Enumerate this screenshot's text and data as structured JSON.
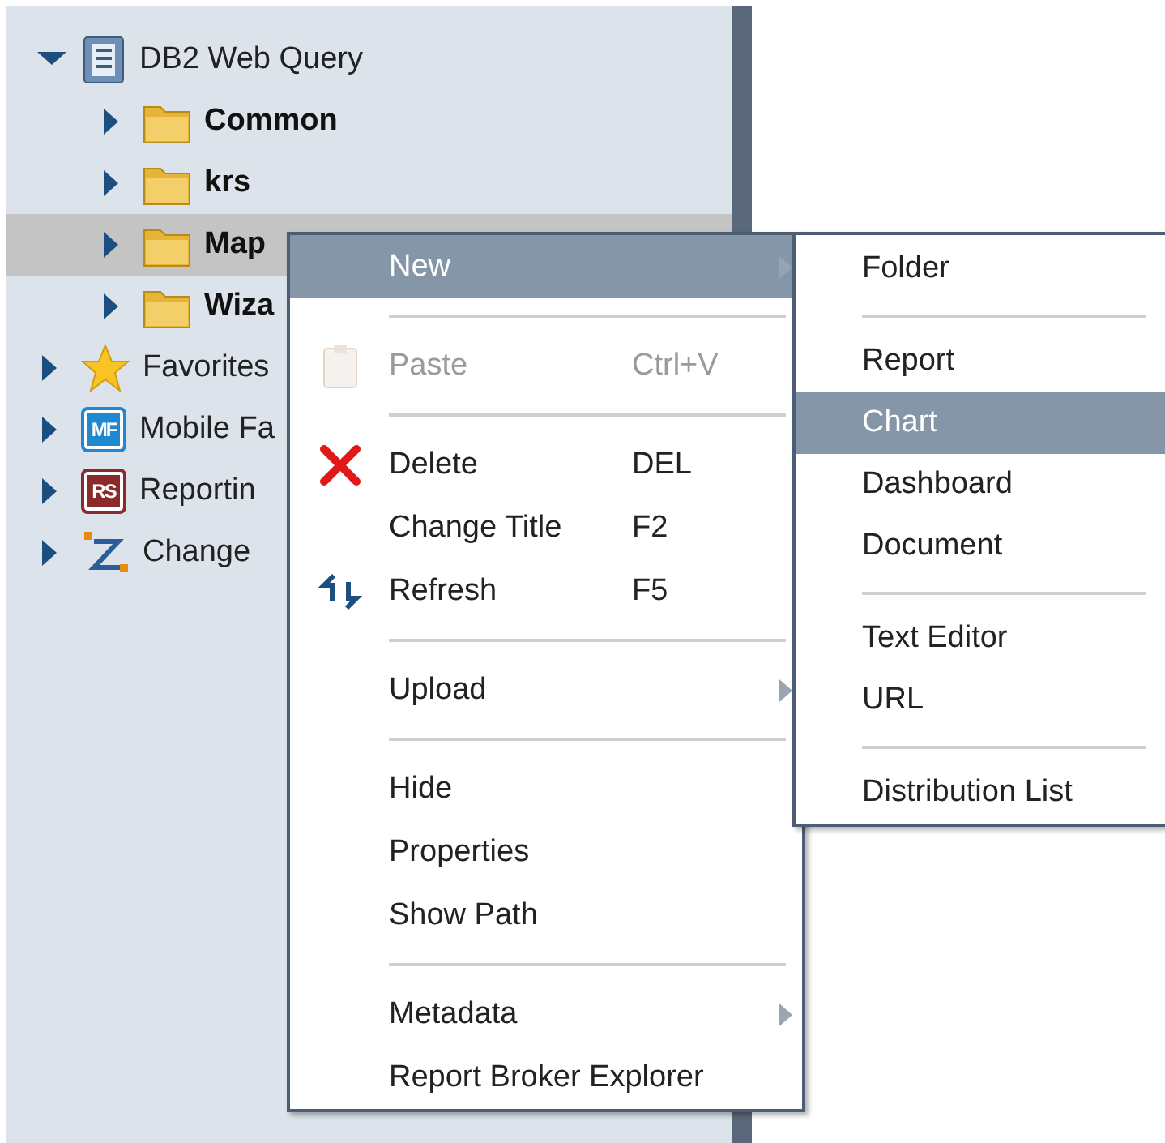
{
  "tree": [
    {
      "label": "DB2 Web Query",
      "kind": "database",
      "expanded": true,
      "bold": false,
      "selected": false,
      "children": [
        {
          "label": "Common",
          "kind": "folder",
          "expanded": false,
          "bold": true,
          "selected": false
        },
        {
          "label": "krs",
          "kind": "folder",
          "expanded": false,
          "bold": true,
          "selected": false
        },
        {
          "label": "Map",
          "kind": "folder",
          "expanded": false,
          "bold": true,
          "selected": true
        },
        {
          "label": "Wiza",
          "kind": "folder",
          "expanded": false,
          "bold": true,
          "selected": false
        }
      ]
    },
    {
      "label": "Favorites",
      "kind": "star",
      "expanded": false,
      "bold": false,
      "selected": false
    },
    {
      "label": "Mobile Fa",
      "kind": "badge",
      "icon_text": "MF",
      "color": "#1e88d0",
      "expanded": false,
      "bold": false,
      "selected": false
    },
    {
      "label": "Reportin",
      "kind": "badge",
      "icon_text": "RS",
      "color": "#8a2a2a",
      "expanded": false,
      "bold": false,
      "selected": false
    },
    {
      "label": "Change",
      "kind": "zigzag",
      "expanded": false,
      "bold": false,
      "selected": false
    }
  ],
  "context_menu": {
    "items": [
      {
        "kind": "item",
        "label": "New",
        "selected": true,
        "disabled": false,
        "submenu": true
      },
      {
        "kind": "separator"
      },
      {
        "kind": "paste",
        "label": "Paste",
        "shortcut": "Ctrl+V",
        "selected": false,
        "disabled": true,
        "submenu": false
      },
      {
        "kind": "separator"
      },
      {
        "kind": "delete",
        "label": "Delete",
        "shortcut": "DEL",
        "selected": false,
        "disabled": false,
        "submenu": false
      },
      {
        "kind": "item",
        "label": "Change Title",
        "shortcut": "F2",
        "selected": false,
        "disabled": false,
        "submenu": false
      },
      {
        "kind": "refresh",
        "label": "Refresh",
        "shortcut": "F5",
        "selected": false,
        "disabled": false,
        "submenu": false
      },
      {
        "kind": "separator"
      },
      {
        "kind": "item",
        "label": "Upload",
        "selected": false,
        "disabled": false,
        "submenu": true
      },
      {
        "kind": "separator"
      },
      {
        "kind": "item",
        "label": "Hide",
        "selected": false,
        "disabled": false,
        "submenu": false
      },
      {
        "kind": "item",
        "label": "Properties",
        "selected": false,
        "disabled": false,
        "submenu": false
      },
      {
        "kind": "item",
        "label": "Show Path",
        "selected": false,
        "disabled": false,
        "submenu": false
      },
      {
        "kind": "separator"
      },
      {
        "kind": "item",
        "label": "Metadata",
        "selected": false,
        "disabled": false,
        "submenu": true
      },
      {
        "kind": "item",
        "label": "Report Broker Explorer",
        "selected": false,
        "disabled": false,
        "submenu": false
      }
    ]
  },
  "submenu": {
    "items": [
      {
        "kind": "item",
        "label": "Folder",
        "selected": false
      },
      {
        "kind": "separator"
      },
      {
        "kind": "item",
        "label": "Report",
        "selected": false
      },
      {
        "kind": "item",
        "label": "Chart",
        "selected": true
      },
      {
        "kind": "item",
        "label": "Dashboard",
        "selected": false
      },
      {
        "kind": "item",
        "label": "Document",
        "selected": false
      },
      {
        "kind": "separator"
      },
      {
        "kind": "item",
        "label": "Text Editor",
        "selected": false
      },
      {
        "kind": "item",
        "label": "URL",
        "selected": false
      },
      {
        "kind": "separator"
      },
      {
        "kind": "item",
        "label": "Distribution List",
        "selected": false
      }
    ]
  }
}
